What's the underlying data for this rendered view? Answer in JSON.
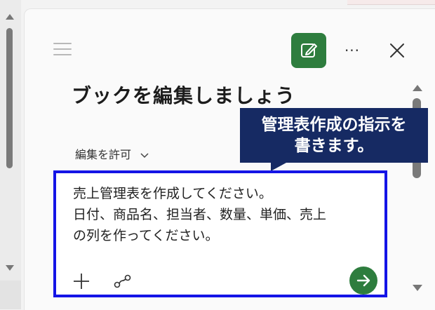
{
  "panel": {
    "title": "ブックを編集しましょう",
    "permission_label": "編集を許可",
    "toolbar": {
      "menu_icon": "hamburger-icon",
      "edit_icon": "edit-icon",
      "more_label": "···",
      "close_icon": "close-icon"
    }
  },
  "callout": {
    "line1": "管理表作成の指示を",
    "line2": "書きます。"
  },
  "prompt": {
    "line1": "売上管理表を作成してください。",
    "line2": "日付、商品名、担当者、数量、単価、売上",
    "line3": "の列を作ってください。",
    "add_icon": "plus-icon",
    "attach_icon": "link-icon",
    "send_icon": "arrow-right-icon"
  },
  "colors": {
    "accent_green": "#2e7d3e",
    "callout_navy": "#162a63",
    "highlight_blue": "#1414e6"
  }
}
